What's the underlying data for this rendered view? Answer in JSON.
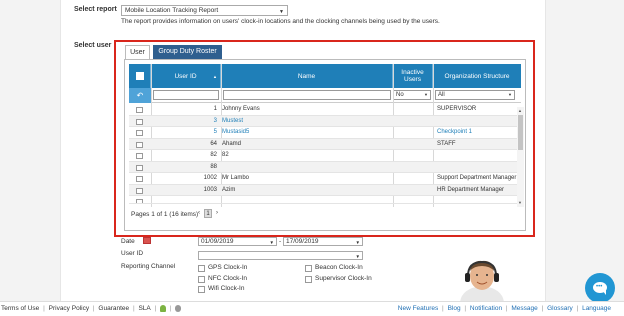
{
  "report": {
    "label": "Select report",
    "selected": "Mobile Location Tracking Report",
    "description": "The report provides information on users' clock-in locations and the clocking channels being used by the users."
  },
  "select_user_label": "Select user",
  "tabs": [
    {
      "label": "User"
    },
    {
      "label": "Group Duty Roster"
    }
  ],
  "grid": {
    "columns": [
      "User ID",
      "Name",
      "Inactive Users",
      "Organization Structure"
    ],
    "filter": {
      "inactive": "No",
      "org": "All"
    },
    "rows": [
      {
        "id": "1",
        "name": "Johnny Evans",
        "org": "SUPERVISOR",
        "link": false
      },
      {
        "id": "3",
        "name": "Mustest",
        "org": "",
        "link": true
      },
      {
        "id": "5",
        "name": "Mustasid5",
        "org": "Checkpoint 1",
        "link": true
      },
      {
        "id": "64",
        "name": "Ahamd",
        "org": "STAFF",
        "link": false
      },
      {
        "id": "82",
        "name": "82",
        "org": "",
        "link": false
      },
      {
        "id": "88",
        "name": "",
        "org": "",
        "link": false
      },
      {
        "id": "1002",
        "name": "Mr Lambo",
        "org": "Support Department Manager",
        "link": false
      },
      {
        "id": "1003",
        "name": "Azim",
        "org": "HR Department Manager",
        "link": false
      }
    ],
    "pager_text": "Pages 1 of 1 (16 items)",
    "current_page": "1"
  },
  "form": {
    "date_label": "Date",
    "date_from": "01/09/2019",
    "date_to": "17/09/2019",
    "date_sep": "-",
    "user_id_label": "User ID",
    "reporting_channel_label": "Reporting Channel",
    "channels": [
      "GPS Clock-In",
      "NFC Clock-In",
      "Wifi Clock-In",
      "Beacon Clock-In",
      "Supervisor Clock-In"
    ]
  },
  "footer": {
    "left": [
      "Terms of Use",
      "Privacy Policy",
      "Guarantee",
      "SLA"
    ],
    "right": [
      "New Features",
      "Blog",
      "Notification",
      "Message",
      "Glossary",
      "Language"
    ]
  },
  "icons": [
    "checkbox-icon",
    "sort-arrow-icon",
    "undo-icon",
    "dropdown-arrow-icon",
    "calendar-icon",
    "android-icon",
    "apple-icon",
    "chat-icon"
  ],
  "colors": {
    "header_blue": "#1f7fb8",
    "tab_dark": "#2f5f8f",
    "highlight_red": "#d9261c",
    "chat_blue": "#2196d3"
  }
}
